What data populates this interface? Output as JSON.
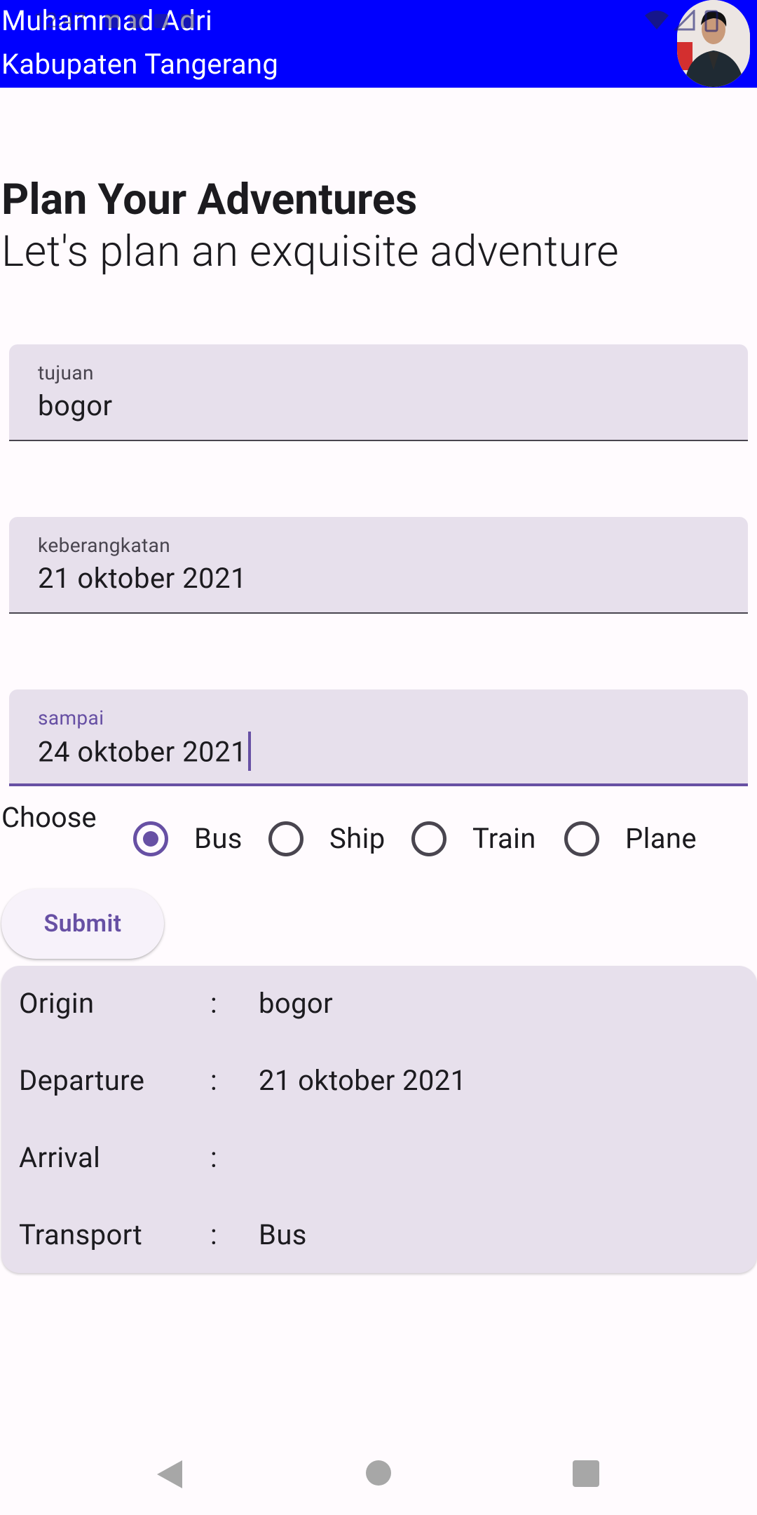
{
  "status_bar": {
    "time": "12:47",
    "icons": [
      "notification-icon",
      "notification-icon",
      "notification-icon",
      "notification-icon",
      "wifi-icon",
      "signal-icon",
      "battery-icon"
    ]
  },
  "header": {
    "name": "Muhammad Adri",
    "location": "Kabupaten Tangerang",
    "avatar_icon": "user-photo"
  },
  "page": {
    "title": "Plan Your Adventures",
    "subtitle": "Let's plan an exquisite adventure"
  },
  "form": {
    "destination": {
      "label": "tujuan",
      "value": "bogor"
    },
    "departure": {
      "label": "keberangkatan",
      "value": "21 oktober 2021"
    },
    "arrival": {
      "label": "sampai",
      "value": "24 oktober 2021"
    }
  },
  "transport": {
    "label": "Choose",
    "options": [
      "Bus",
      "Ship",
      "Train",
      "Plane"
    ],
    "selected": "Bus"
  },
  "submit": {
    "label": "Submit"
  },
  "summary": {
    "rows": [
      {
        "key": "Origin",
        "sep": ":",
        "value": "bogor"
      },
      {
        "key": "Departure",
        "sep": ":",
        "value": "21 oktober 2021"
      },
      {
        "key": "Arrival",
        "sep": ":",
        "value": ""
      },
      {
        "key": "Transport",
        "sep": ":",
        "value": "Bus"
      }
    ]
  },
  "colors": {
    "header_bg": "#0000ff",
    "accent": "#6750a4",
    "field_bg": "#e7e0ec"
  }
}
